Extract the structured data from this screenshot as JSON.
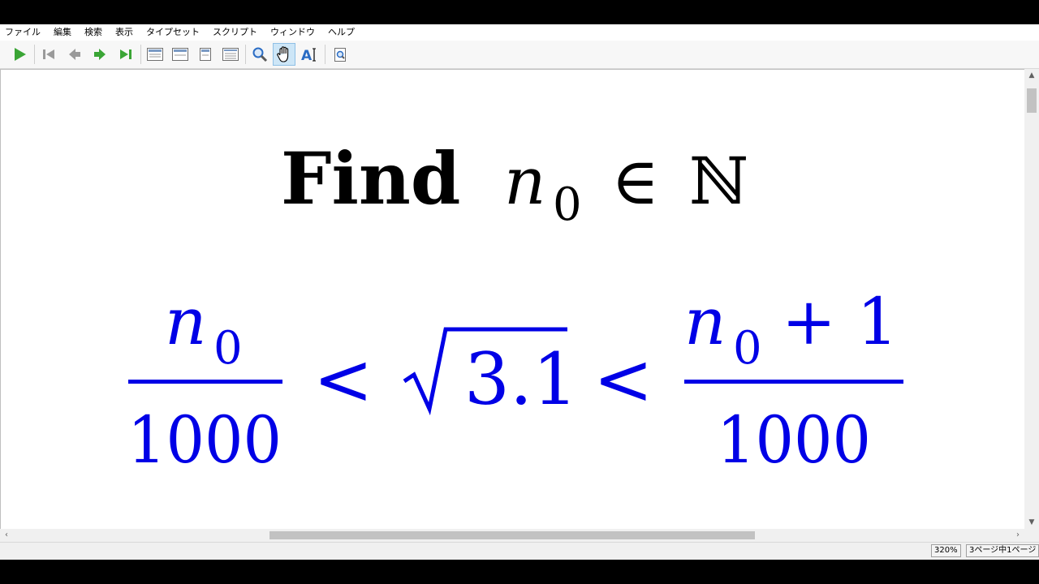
{
  "menu": {
    "items": [
      "ファイル",
      "編集",
      "検索",
      "表示",
      "タイプセット",
      "スクリプト",
      "ウィンドウ",
      "ヘルプ"
    ]
  },
  "toolbar": {
    "buttons": [
      {
        "name": "typeset-icon",
        "label": "Typeset"
      },
      {
        "name": "first-page-icon",
        "label": "First page"
      },
      {
        "name": "prev-page-icon",
        "label": "Previous page"
      },
      {
        "name": "next-page-icon",
        "label": "Next page"
      },
      {
        "name": "last-page-icon",
        "label": "Last page"
      },
      {
        "name": "actual-size-icon",
        "label": "Actual size"
      },
      {
        "name": "fit-width-icon",
        "label": "Fit width"
      },
      {
        "name": "fit-page-icon",
        "label": "Fit page"
      },
      {
        "name": "fit-window-icon",
        "label": "Fit window"
      },
      {
        "name": "magnify-icon",
        "label": "Magnify"
      },
      {
        "name": "hand-icon",
        "label": "Scroll"
      },
      {
        "name": "select-text-icon",
        "label": "Select text"
      },
      {
        "name": "find-icon",
        "label": "Find"
      }
    ],
    "active": "hand-icon",
    "colors": {
      "green": "#3aa535",
      "gray": "#9a9a9a",
      "blue": "#2a6cc4"
    }
  },
  "document": {
    "title_word": "Find",
    "title_var": "n",
    "title_sub": "0",
    "title_rel": "∈",
    "title_set": "ℕ",
    "ineq": {
      "left_num_var": "n",
      "left_num_sub": "0",
      "left_den": "1000",
      "lt1": "<",
      "sqrt_arg": "3.1",
      "lt2": "<",
      "right_num_var": "n",
      "right_num_sub": "0",
      "right_num_rest": "+ 1",
      "right_den": "1000"
    },
    "colors": {
      "title": "#000000",
      "math": "#0000e6"
    }
  },
  "status": {
    "zoom": "320%",
    "page": "3ページ中1ページ"
  }
}
